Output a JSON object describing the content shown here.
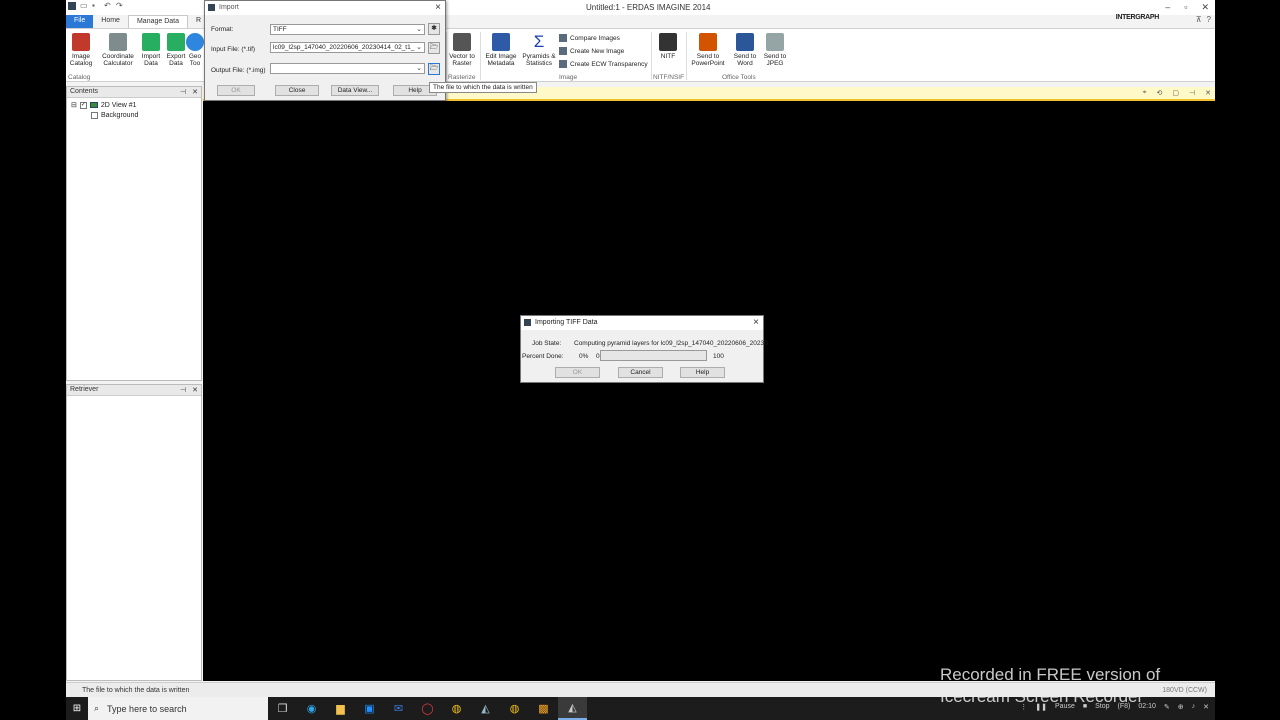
{
  "app": {
    "title": "Untitled:1 - ERDAS IMAGINE 2014",
    "brand": "INTERGRAPH"
  },
  "ribbon": {
    "tabs": [
      "File",
      "Home",
      "Manage Data",
      "R"
    ],
    "buttons": {
      "image_catalog": "Image Catalog",
      "coord_calc": "Coordinate Calculator",
      "import_data": "Import Data",
      "export_data": "Export Data",
      "geo_tools": "Geo Too",
      "vector_to_raster": "Vector to Raster",
      "edit_metadata": "Edit Image Metadata",
      "pyramids": "Pyramids & Statistics",
      "compare_images": "Compare Images",
      "create_new_image": "Create New Image",
      "create_ecw": "Create ECW Transparency",
      "nitf": "NITF",
      "send_ppt": "Send to PowerPoint",
      "send_word": "Send to Word",
      "send_jpeg": "Send to JPEG"
    },
    "groups": {
      "catalog": "Catalog",
      "rasterize": "Rasterize",
      "image": "Image",
      "nitf": "NITF/NSIF",
      "office": "Office Tools"
    }
  },
  "contents_panel": {
    "title": "Contents",
    "view_name": "2D View #1",
    "layer": "Background"
  },
  "retriever_panel": {
    "title": "Retriever"
  },
  "import_dialog": {
    "title": "Import",
    "format_label": "Format:",
    "format_value": "TIFF",
    "input_label": "Input File: (*.tif)",
    "input_value": "lc09_l2sp_147040_20220606_20230414_02_t1_",
    "output_label": "Output File: (*.img)",
    "output_value": "",
    "ok": "OK",
    "close": "Close",
    "data_view": "Data View...",
    "help": "Help",
    "tooltip": "The file to which the data is written"
  },
  "progress_dialog": {
    "title": "Importing TIFF Data",
    "job_state_label": "Job State:",
    "job_state_value": "Computing pyramid layers for lc09_l2sp_147040_20220606_20230",
    "percent_label": "Percent Done:",
    "percent_value": "0%",
    "scale_min": "0",
    "scale_max": "100",
    "progress_fraction": 0.0,
    "ok": "OK",
    "cancel": "Cancel",
    "help": "Help"
  },
  "status": {
    "message": "The file to which the data is written",
    "coords": "180VD (CCW)"
  },
  "taskbar": {
    "search_placeholder": "Type here to search",
    "pause": "Pause",
    "stop": "Stop",
    "stop_hint": "(F8)",
    "time": "02:10"
  },
  "watermark": {
    "line1": "Recorded in FREE version of",
    "line2": "Icecream  Screen  Recorder"
  },
  "colors": {
    "accent": "#2b78d6",
    "view_header": "#fff9c8",
    "progress_fill": "#06b025"
  }
}
